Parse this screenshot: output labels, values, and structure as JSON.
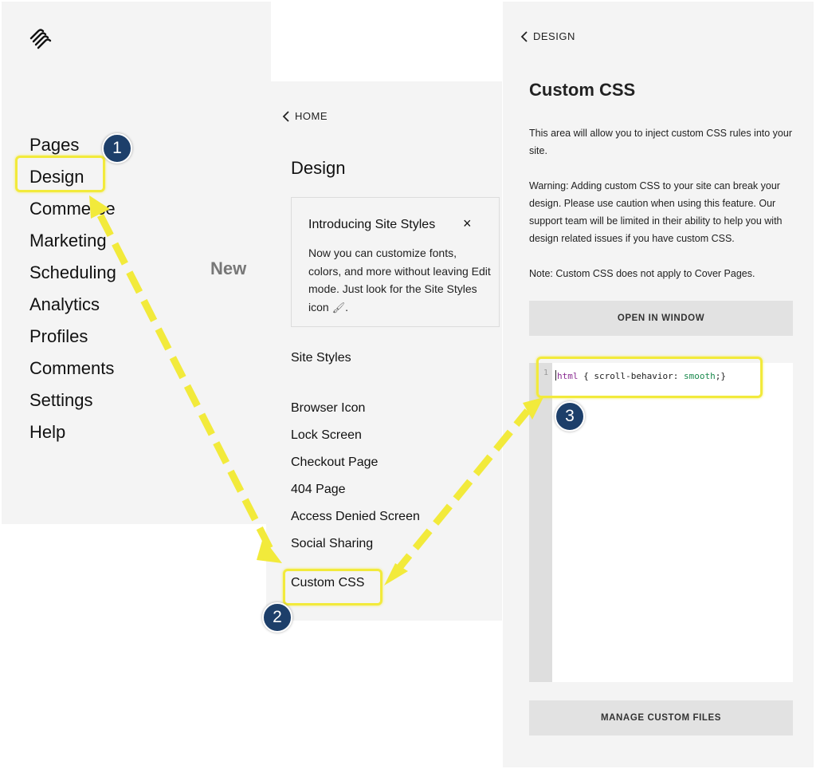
{
  "panel_home": {
    "logo_icon": "squarespace-logo-icon",
    "nav_items": [
      "Pages",
      "Design",
      "Commerce",
      "Marketing",
      "Scheduling",
      "Analytics",
      "Profiles",
      "Comments",
      "Settings",
      "Help"
    ],
    "new_badge": "New"
  },
  "panel_design": {
    "back_label": "HOME",
    "title": "Design",
    "card": {
      "title": "Introducing Site Styles",
      "close_label": "×",
      "body": "Now you can customize fonts, colors, and more without leaving Edit mode. Just look for the Site Styles icon",
      "body_end": ".",
      "icon": "paintbrush-icon"
    },
    "site_styles": "Site Styles",
    "items": [
      "Browser Icon",
      "Lock Screen",
      "Checkout Page",
      "404 Page",
      "Access Denied Screen",
      "Social Sharing"
    ],
    "custom_css": "Custom CSS"
  },
  "panel_css": {
    "back_label": "DESIGN",
    "title": "Custom CSS",
    "intro": "This area will allow you to inject custom CSS rules into your site.",
    "warning": "Warning: Adding custom CSS to your site can break your design. Please use caution when using this feature. Our support team will be limited in their ability to help you with design related issues if you have custom CSS.",
    "note": "Note: Custom CSS does not apply to Cover Pages.",
    "open_window": "OPEN IN WINDOW",
    "editor": {
      "line_number": "1",
      "code_tag": "html",
      "code_mid": " { scroll-behavior: ",
      "code_value": "smooth",
      "code_end": ";}"
    },
    "manage_files": "MANAGE CUSTOM FILES"
  },
  "steps": [
    "1",
    "2",
    "3"
  ],
  "colors": {
    "highlight": "#f2ea3b",
    "step_badge": "#1d3f6a",
    "panel_bg": "#f4f4f4"
  }
}
